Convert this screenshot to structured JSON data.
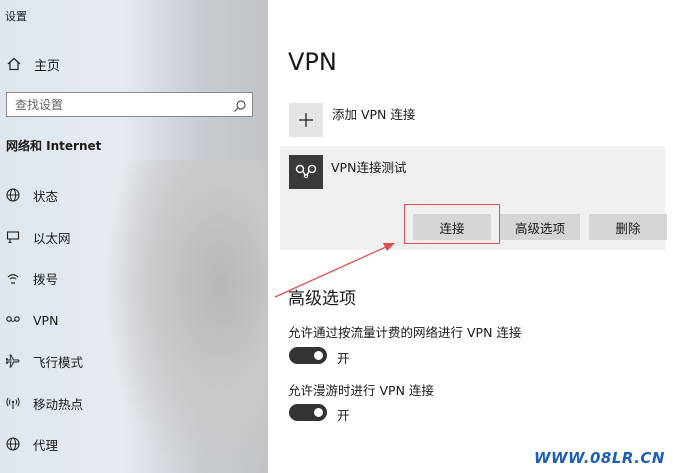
{
  "window": {
    "title": "设置"
  },
  "sidebar": {
    "home_label": "主页",
    "search_placeholder": "查找设置",
    "section_title": "网络和 Internet",
    "items": [
      {
        "label": "状态",
        "icon": "globe-icon"
      },
      {
        "label": "以太网",
        "icon": "ethernet-icon"
      },
      {
        "label": "拨号",
        "icon": "dialup-icon"
      },
      {
        "label": "VPN",
        "icon": "vpn-icon"
      },
      {
        "label": "飞行模式",
        "icon": "airplane-icon"
      },
      {
        "label": "移动热点",
        "icon": "hotspot-icon"
      },
      {
        "label": "代理",
        "icon": "globe-icon"
      }
    ]
  },
  "main": {
    "title": "VPN",
    "add_vpn_label": "添加 VPN 连接",
    "connection": {
      "name": "VPN连接测试",
      "buttons": {
        "connect": "连接",
        "advanced": "高级选项",
        "delete": "删除"
      }
    },
    "advanced": {
      "title": "高级选项",
      "metered": {
        "label": "允许通过按流量计费的网络进行 VPN 连接",
        "state": "开",
        "on": true
      },
      "roaming": {
        "label": "允许漫游时进行 VPN 连接",
        "state": "开",
        "on": true
      }
    }
  },
  "watermark": "WWW.08LR.CN",
  "colors": {
    "annotation": "#e05050",
    "toggle_on": "#333333",
    "watermark": "#1d5fb8"
  }
}
